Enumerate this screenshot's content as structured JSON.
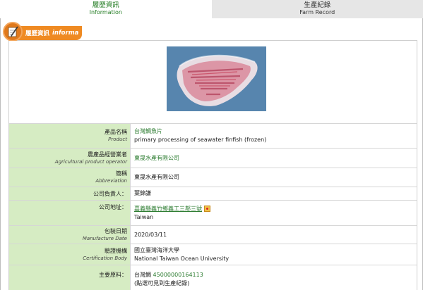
{
  "tabs": [
    {
      "zh": "履歷資訊",
      "en": "Information",
      "active": true
    },
    {
      "zh": "生產紀錄",
      "en": "Farm Record",
      "active": false
    }
  ],
  "section": {
    "zh_title": "履歷資訊",
    "en_title": "informa",
    "icon": "pen-paper-icon"
  },
  "product_image": {
    "alt": "tilapia fillet photo",
    "icon": "fish-fillet-image"
  },
  "fields": {
    "product": {
      "label_zh": "產品名稱",
      "label_en": "Product",
      "value_zh": "台灣鯛魚片",
      "value_en": "primary processing of seawater finfish (frozen)"
    },
    "operator": {
      "label_zh": "農產品經營業者",
      "label_en": "Agricultural product operator",
      "value": "東晟水產有限公司"
    },
    "abbreviation": {
      "label_zh": "簡稱",
      "label_en": "Abbreviation",
      "value": "東晟水產有限公司"
    },
    "principal": {
      "label_zh": "公司負責人：",
      "value": "葉錦謙"
    },
    "address": {
      "label_zh": "公司地址：",
      "value_zh": "嘉義縣義竹鄉義工三鄰三號",
      "value_en": "Taiwan",
      "icon": "map-icon"
    },
    "pack_date": {
      "label_zh": "包裝日期",
      "label_en": "Manufacture Date",
      "value": "2020/03/11"
    },
    "certification": {
      "label_zh": "驗證機構",
      "label_en": "Certification Body",
      "value_zh": "國立臺灣海洋大學",
      "value_en": "National Taiwan Ocean University"
    },
    "materials": {
      "label_zh": "主要原料：",
      "value_prefix": "台灣鯛",
      "value_code": "45000000164113",
      "value_note": "(點選可見到生產紀錄)"
    }
  },
  "colors": {
    "label_bg": "#d6ecc3",
    "accent_green": "#2e7d32",
    "header_orange": "#ef8a22"
  }
}
